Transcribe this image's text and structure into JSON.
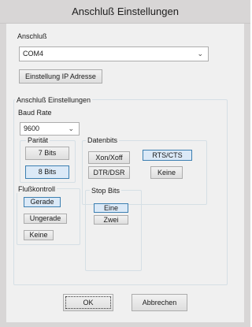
{
  "window": {
    "title": "Anschluß Einstellungen"
  },
  "port": {
    "label": "Anschluß",
    "selected": "COM4",
    "ip_button": "Einstellung IP Adresse"
  },
  "settings": {
    "label": "Anschluß Einstellungen",
    "baud_label": "Baud Rate",
    "baud_selected": "9600",
    "paritaet": {
      "label": "Parität",
      "opt_7bits": "7 Bits",
      "opt_8bits": "8 Bits"
    },
    "datenbits": {
      "label": "Datenbits",
      "xon": "Xon/Xoff",
      "rts": "RTS/CTS",
      "dtr": "DTR/DSR",
      "keine": "Keine"
    },
    "flusskontroll": {
      "label": "Flußkontroll",
      "gerade": "Gerade",
      "ungerade": "Ungerade",
      "keine": "Keine"
    },
    "stopbits": {
      "label": "Stop Bits",
      "eine": "Eine",
      "zwei": "Zwei"
    }
  },
  "actions": {
    "ok": "OK",
    "cancel": "Abbrechen"
  },
  "icons": {
    "dropdown": "chevron-down-icon"
  }
}
